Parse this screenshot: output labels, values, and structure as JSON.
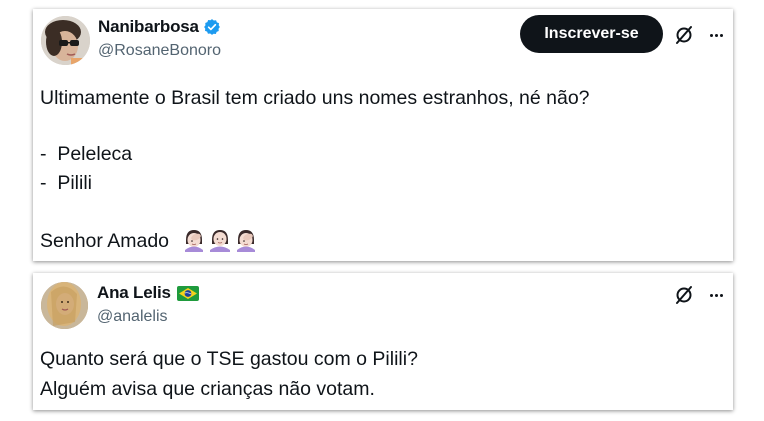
{
  "tweets": [
    {
      "display_name": "Nanibarbosa",
      "handle": "@RosaneBonoro",
      "verified": true,
      "subscribe_label": "Inscrever-se",
      "lines": [
        "Ultimamente o Brasil tem criado uns nomes estranhos, né não?",
        "-  Peleleca",
        "-  Pilili",
        "Senhor Amado"
      ],
      "emojis": [
        "facepalm-woman-emoji",
        "shrug-woman-emoji",
        "facepalm-woman-emoji"
      ]
    },
    {
      "display_name": "Ana Lelis",
      "handle": "@analelis",
      "flag": "brazil-flag-emoji",
      "lines": [
        "Quanto será que o TSE gastou com o Pilili?",
        "Alguém avisa que crianças não votam."
      ]
    }
  ],
  "icons": {
    "verified": "verified-badge-icon",
    "grok": "grok-icon",
    "more": "more-options-icon"
  },
  "colors": {
    "text": "#0f1419",
    "secondary_text": "#536471",
    "verified_blue": "#1d9bf0",
    "button_bg": "#0f1419",
    "button_text": "#ffffff"
  }
}
